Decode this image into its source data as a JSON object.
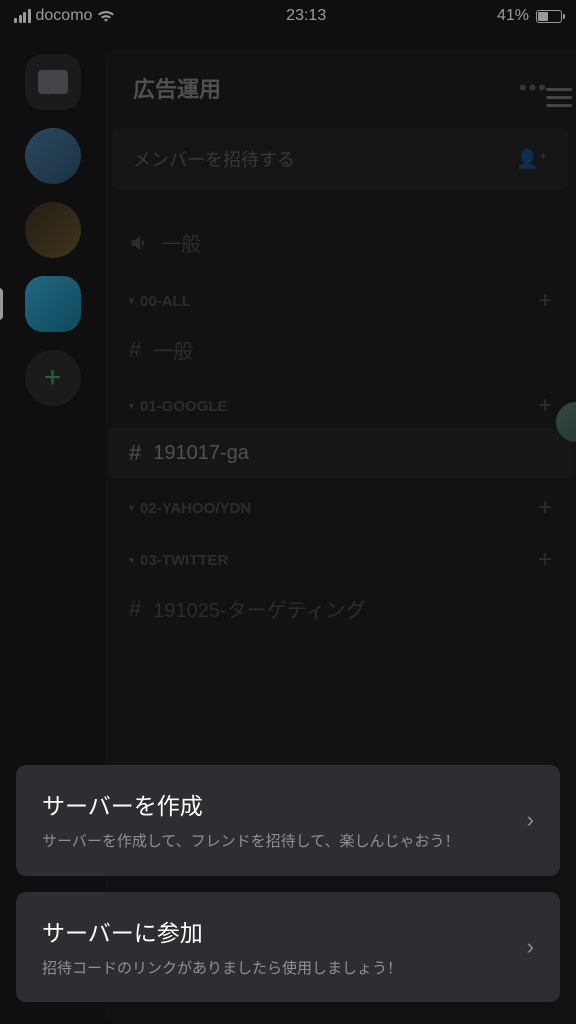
{
  "status": {
    "carrier": "docomo",
    "time": "23:13",
    "battery_pct": "41%"
  },
  "server": {
    "title": "広告運用",
    "invite_label": "メンバーを招待する",
    "voice_channel": "一般",
    "categories": [
      {
        "name": "00-ALL",
        "channel": "一般",
        "active": false
      },
      {
        "name": "01-GOOGLE",
        "channel": "191017-ga",
        "active": true
      },
      {
        "name": "02-YAHOO/YDN",
        "channel": null
      },
      {
        "name": "03-TWITTER",
        "channel": "191025-ターゲティング",
        "active": false
      }
    ]
  },
  "sheet": {
    "create": {
      "title": "サーバーを作成",
      "sub": "サーバーを作成して、フレンドを招待して、楽しんじゃおう！"
    },
    "join": {
      "title": "サーバーに参加",
      "sub": "招待コードのリンクがありましたら使用しましょう！"
    }
  }
}
